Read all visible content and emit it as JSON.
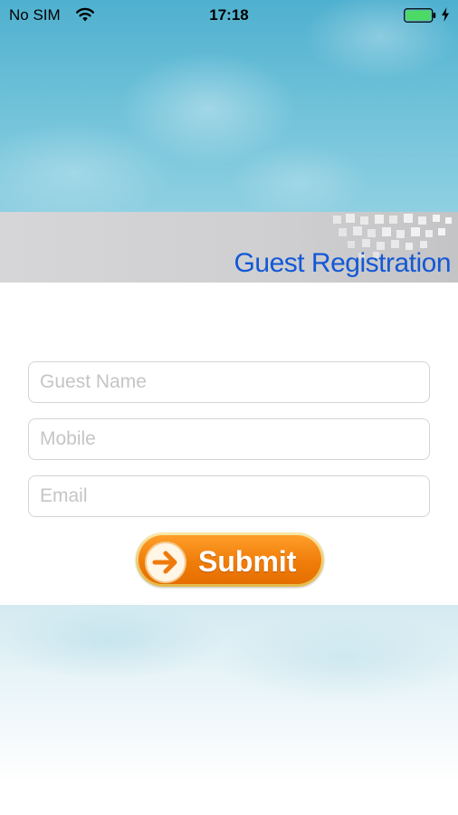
{
  "status_bar": {
    "carrier": "No SIM",
    "time": "17:18",
    "wifi_icon": "wifi-icon",
    "battery_icon": "battery-charging-icon",
    "battery_color": "#4cd964"
  },
  "banner": {
    "title": "Guest Registration",
    "title_color": "#1358d6"
  },
  "form": {
    "guest_name": {
      "value": "",
      "placeholder": "Guest Name"
    },
    "mobile": {
      "value": "",
      "placeholder": "Mobile"
    },
    "email": {
      "value": "",
      "placeholder": "Email"
    },
    "submit": {
      "label": "Submit",
      "icon": "arrow-right-circle-icon",
      "color": "#f07d0a"
    }
  }
}
